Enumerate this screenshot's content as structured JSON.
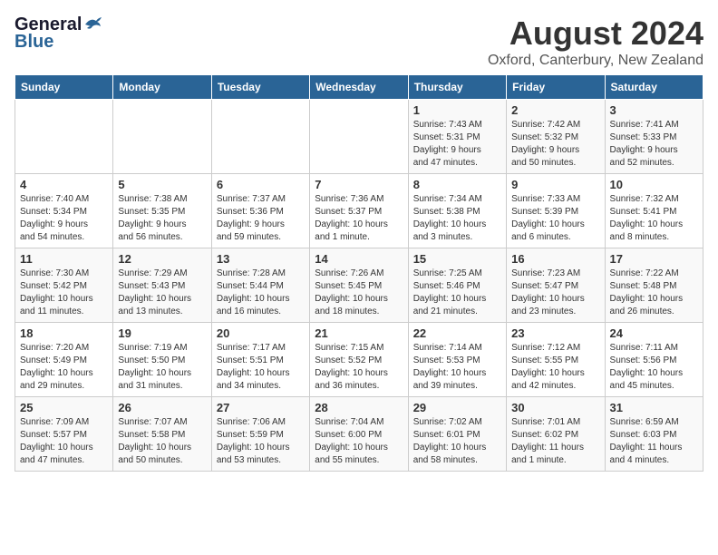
{
  "logo": {
    "general": "General",
    "blue": "Blue"
  },
  "title": "August 2024",
  "subtitle": "Oxford, Canterbury, New Zealand",
  "days_of_week": [
    "Sunday",
    "Monday",
    "Tuesday",
    "Wednesday",
    "Thursday",
    "Friday",
    "Saturday"
  ],
  "weeks": [
    [
      {
        "day": "",
        "info": ""
      },
      {
        "day": "",
        "info": ""
      },
      {
        "day": "",
        "info": ""
      },
      {
        "day": "",
        "info": ""
      },
      {
        "day": "1",
        "info": "Sunrise: 7:43 AM\nSunset: 5:31 PM\nDaylight: 9 hours\nand 47 minutes."
      },
      {
        "day": "2",
        "info": "Sunrise: 7:42 AM\nSunset: 5:32 PM\nDaylight: 9 hours\nand 50 minutes."
      },
      {
        "day": "3",
        "info": "Sunrise: 7:41 AM\nSunset: 5:33 PM\nDaylight: 9 hours\nand 52 minutes."
      }
    ],
    [
      {
        "day": "4",
        "info": "Sunrise: 7:40 AM\nSunset: 5:34 PM\nDaylight: 9 hours\nand 54 minutes."
      },
      {
        "day": "5",
        "info": "Sunrise: 7:38 AM\nSunset: 5:35 PM\nDaylight: 9 hours\nand 56 minutes."
      },
      {
        "day": "6",
        "info": "Sunrise: 7:37 AM\nSunset: 5:36 PM\nDaylight: 9 hours\nand 59 minutes."
      },
      {
        "day": "7",
        "info": "Sunrise: 7:36 AM\nSunset: 5:37 PM\nDaylight: 10 hours\nand 1 minute."
      },
      {
        "day": "8",
        "info": "Sunrise: 7:34 AM\nSunset: 5:38 PM\nDaylight: 10 hours\nand 3 minutes."
      },
      {
        "day": "9",
        "info": "Sunrise: 7:33 AM\nSunset: 5:39 PM\nDaylight: 10 hours\nand 6 minutes."
      },
      {
        "day": "10",
        "info": "Sunrise: 7:32 AM\nSunset: 5:41 PM\nDaylight: 10 hours\nand 8 minutes."
      }
    ],
    [
      {
        "day": "11",
        "info": "Sunrise: 7:30 AM\nSunset: 5:42 PM\nDaylight: 10 hours\nand 11 minutes."
      },
      {
        "day": "12",
        "info": "Sunrise: 7:29 AM\nSunset: 5:43 PM\nDaylight: 10 hours\nand 13 minutes."
      },
      {
        "day": "13",
        "info": "Sunrise: 7:28 AM\nSunset: 5:44 PM\nDaylight: 10 hours\nand 16 minutes."
      },
      {
        "day": "14",
        "info": "Sunrise: 7:26 AM\nSunset: 5:45 PM\nDaylight: 10 hours\nand 18 minutes."
      },
      {
        "day": "15",
        "info": "Sunrise: 7:25 AM\nSunset: 5:46 PM\nDaylight: 10 hours\nand 21 minutes."
      },
      {
        "day": "16",
        "info": "Sunrise: 7:23 AM\nSunset: 5:47 PM\nDaylight: 10 hours\nand 23 minutes."
      },
      {
        "day": "17",
        "info": "Sunrise: 7:22 AM\nSunset: 5:48 PM\nDaylight: 10 hours\nand 26 minutes."
      }
    ],
    [
      {
        "day": "18",
        "info": "Sunrise: 7:20 AM\nSunset: 5:49 PM\nDaylight: 10 hours\nand 29 minutes."
      },
      {
        "day": "19",
        "info": "Sunrise: 7:19 AM\nSunset: 5:50 PM\nDaylight: 10 hours\nand 31 minutes."
      },
      {
        "day": "20",
        "info": "Sunrise: 7:17 AM\nSunset: 5:51 PM\nDaylight: 10 hours\nand 34 minutes."
      },
      {
        "day": "21",
        "info": "Sunrise: 7:15 AM\nSunset: 5:52 PM\nDaylight: 10 hours\nand 36 minutes."
      },
      {
        "day": "22",
        "info": "Sunrise: 7:14 AM\nSunset: 5:53 PM\nDaylight: 10 hours\nand 39 minutes."
      },
      {
        "day": "23",
        "info": "Sunrise: 7:12 AM\nSunset: 5:55 PM\nDaylight: 10 hours\nand 42 minutes."
      },
      {
        "day": "24",
        "info": "Sunrise: 7:11 AM\nSunset: 5:56 PM\nDaylight: 10 hours\nand 45 minutes."
      }
    ],
    [
      {
        "day": "25",
        "info": "Sunrise: 7:09 AM\nSunset: 5:57 PM\nDaylight: 10 hours\nand 47 minutes."
      },
      {
        "day": "26",
        "info": "Sunrise: 7:07 AM\nSunset: 5:58 PM\nDaylight: 10 hours\nand 50 minutes."
      },
      {
        "day": "27",
        "info": "Sunrise: 7:06 AM\nSunset: 5:59 PM\nDaylight: 10 hours\nand 53 minutes."
      },
      {
        "day": "28",
        "info": "Sunrise: 7:04 AM\nSunset: 6:00 PM\nDaylight: 10 hours\nand 55 minutes."
      },
      {
        "day": "29",
        "info": "Sunrise: 7:02 AM\nSunset: 6:01 PM\nDaylight: 10 hours\nand 58 minutes."
      },
      {
        "day": "30",
        "info": "Sunrise: 7:01 AM\nSunset: 6:02 PM\nDaylight: 11 hours\nand 1 minute."
      },
      {
        "day": "31",
        "info": "Sunrise: 6:59 AM\nSunset: 6:03 PM\nDaylight: 11 hours\nand 4 minutes."
      }
    ]
  ]
}
